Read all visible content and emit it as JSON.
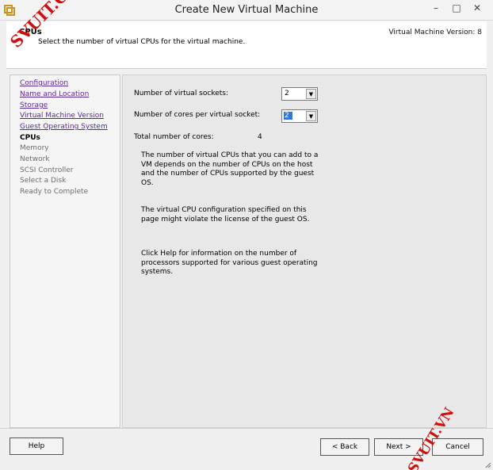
{
  "window": {
    "title": "Create New Virtual Machine",
    "minimize_glyph": "–",
    "maximize_glyph": "□",
    "close_glyph": "✕"
  },
  "header": {
    "title": "CPUs",
    "description": "Select the number of virtual CPUs for the virtual machine.",
    "version": "Virtual Machine Version: 8"
  },
  "nav": {
    "items": [
      {
        "label": "Configuration",
        "state": "completed"
      },
      {
        "label": "Name and Location",
        "state": "completed"
      },
      {
        "label": "Storage",
        "state": "completed"
      },
      {
        "label": "Virtual Machine Version",
        "state": "completed"
      },
      {
        "label": "Guest Operating System",
        "state": "completed"
      },
      {
        "label": "CPUs",
        "state": "current"
      },
      {
        "label": "Memory",
        "state": "pending"
      },
      {
        "label": "Network",
        "state": "pending"
      },
      {
        "label": "SCSI Controller",
        "state": "pending"
      },
      {
        "label": "Select a Disk",
        "state": "pending"
      },
      {
        "label": "Ready to Complete",
        "state": "pending"
      }
    ]
  },
  "form": {
    "sockets_label": "Number of virtual sockets:",
    "sockets_value": "2",
    "cores_label": "Number of cores per virtual socket:",
    "cores_value": "2",
    "total_label": "Total number of cores:",
    "total_value": "4",
    "dropdown_glyph": "▼"
  },
  "info": {
    "para1": "The number of virtual CPUs that you can add to a VM depends on the number of CPUs on the host and the number of CPUs supported by the guest OS.",
    "para2": "The virtual CPU configuration specified on this page might violate the license of the guest OS.",
    "para3": "Click Help for information on the number of processors supported for various guest operating systems."
  },
  "footer": {
    "help": "Help",
    "back": "< Back",
    "next": "Next >",
    "cancel": "Cancel"
  },
  "watermarks": {
    "top_left": "SVUIT.COM",
    "bottom_right": "SVUIT.VN"
  },
  "colors": {
    "link": "#5b2a9a",
    "selection": "#3378d8",
    "watermark": "#cc1111"
  }
}
